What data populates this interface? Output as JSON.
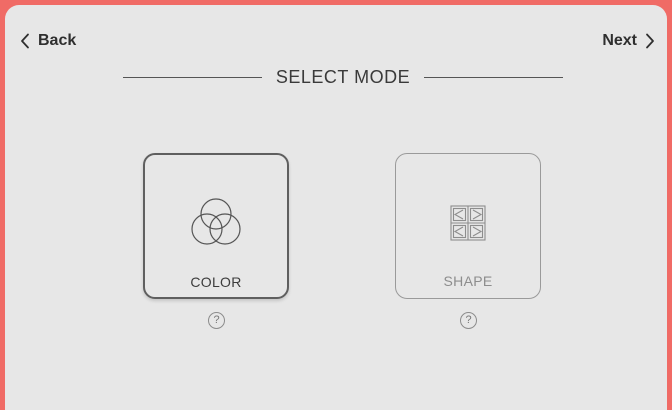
{
  "nav": {
    "back_label": "Back",
    "next_label": "Next",
    "back_icon": "chevron-left-icon",
    "next_icon": "chevron-right-icon"
  },
  "header": {
    "title": "SELECT MODE"
  },
  "modes": [
    {
      "label": "COLOR",
      "icon": "color-circles-icon",
      "selected": true,
      "help": "?"
    },
    {
      "label": "SHAPE",
      "icon": "shape-grid-icon",
      "selected": false,
      "help": "?"
    }
  ],
  "colors": {
    "frame": "#f06b66",
    "screen": "#e7e7e7",
    "text_dark": "#2f2f2f",
    "text_muted": "#8d8d8d"
  }
}
